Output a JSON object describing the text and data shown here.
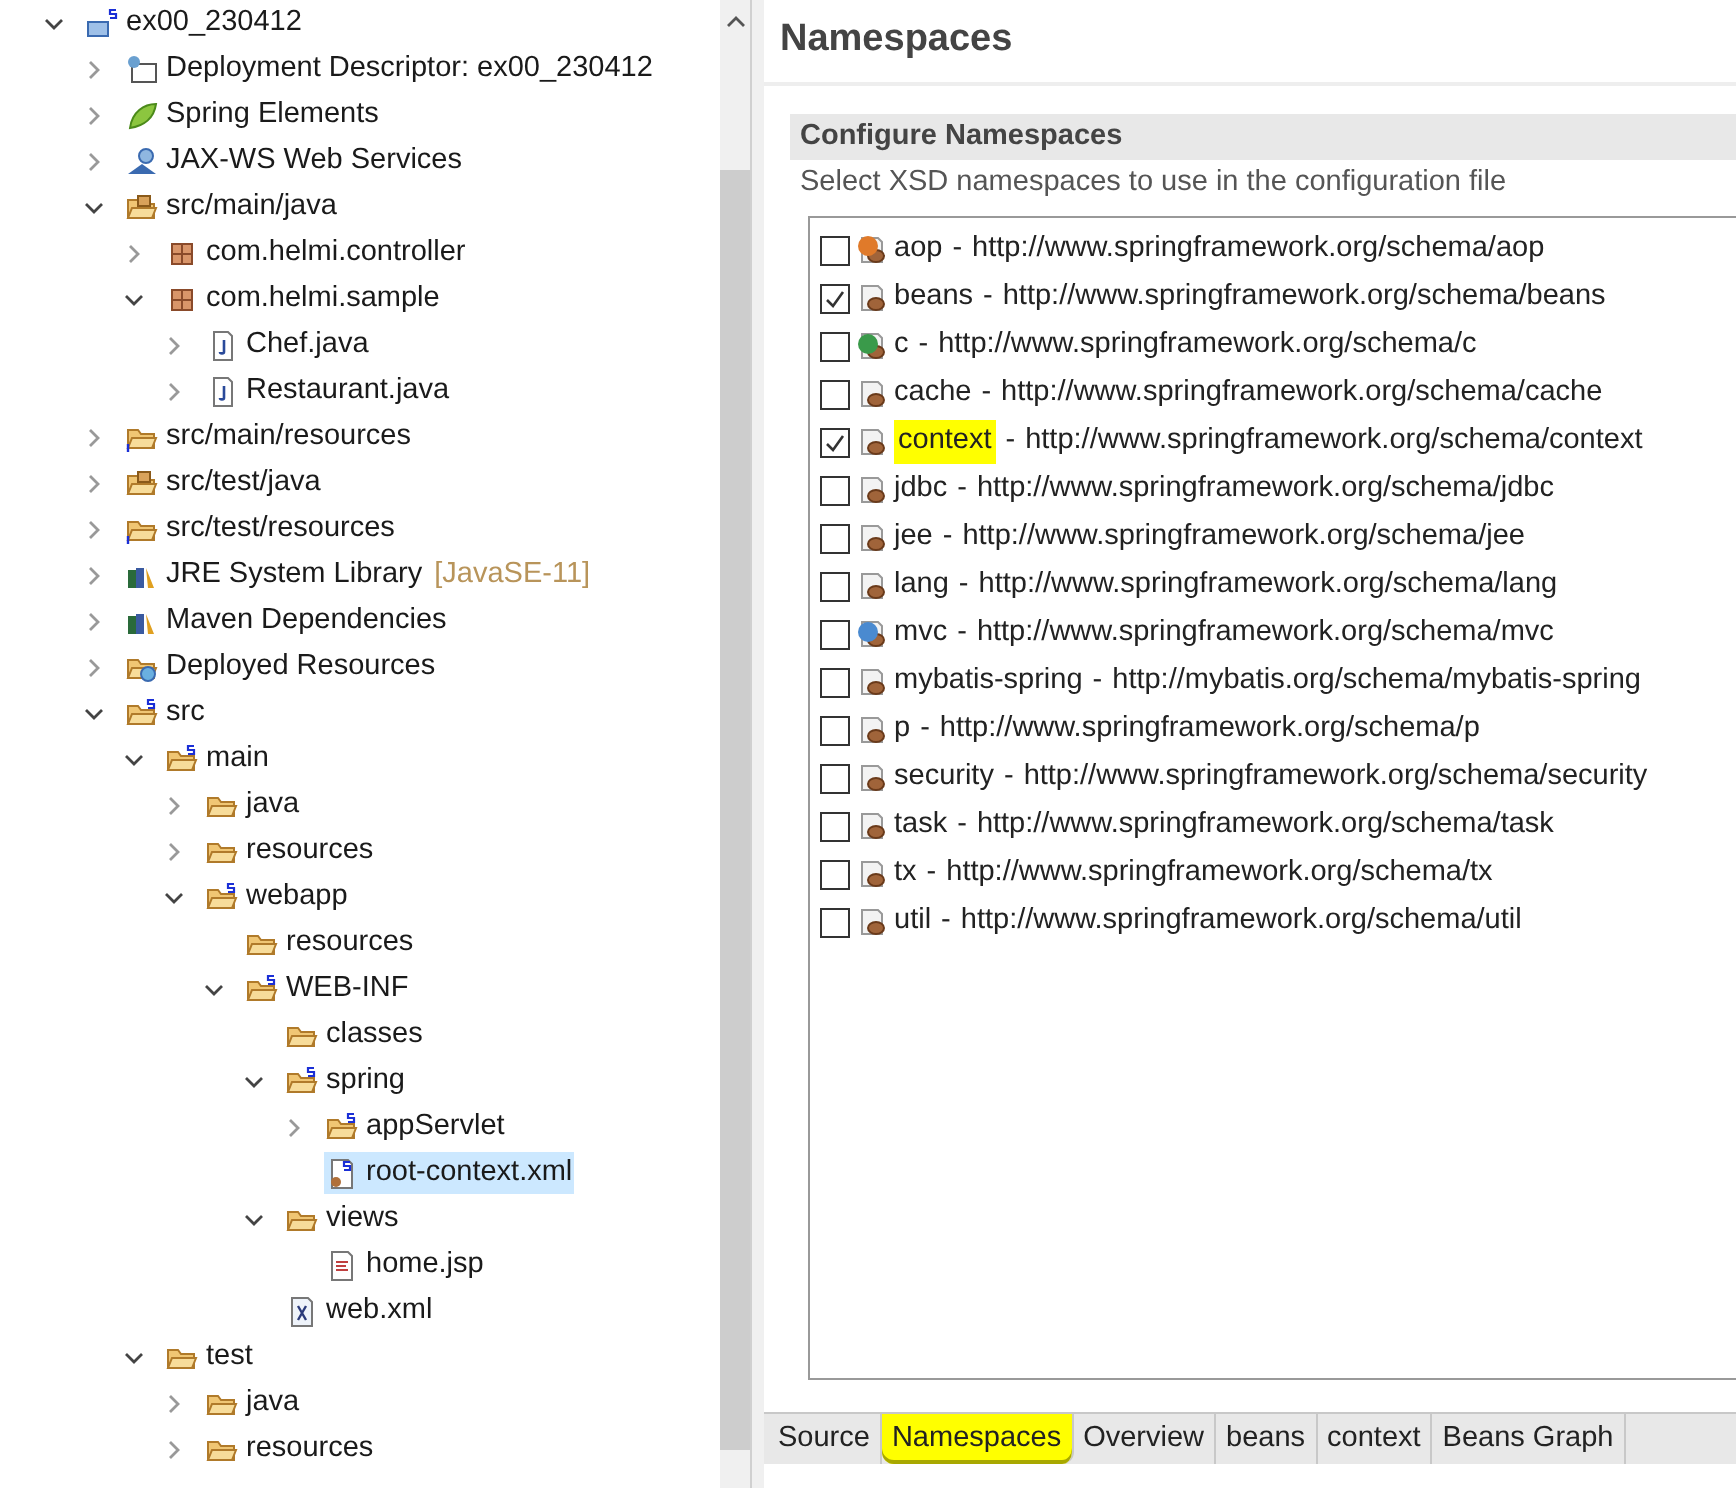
{
  "tree": [
    {
      "label": "ex00_230412",
      "kind": "project",
      "expanded": true,
      "children": [
        {
          "label": "Deployment Descriptor: ex00_230412",
          "kind": "descriptor",
          "expanded": false
        },
        {
          "label": "Spring Elements",
          "kind": "leaf",
          "expanded": false
        },
        {
          "label": "JAX-WS Web Services",
          "kind": "webservice",
          "expanded": false
        },
        {
          "label": "src/main/java",
          "kind": "source-folder",
          "expanded": true,
          "children": [
            {
              "label": "com.helmi.controller",
              "kind": "package",
              "expanded": false
            },
            {
              "label": "com.helmi.sample",
              "kind": "package",
              "expanded": true,
              "children": [
                {
                  "label": "Chef.java",
                  "kind": "java-file",
                  "expanded": false
                },
                {
                  "label": "Restaurant.java",
                  "kind": "java-file",
                  "expanded": false
                }
              ]
            }
          ]
        },
        {
          "label": "src/main/resources",
          "kind": "resource-folder",
          "expanded": false
        },
        {
          "label": "src/test/java",
          "kind": "source-folder",
          "expanded": false
        },
        {
          "label": "src/test/resources",
          "kind": "resource-folder",
          "expanded": false
        },
        {
          "label": "JRE System Library",
          "suffix": "[JavaSE-11]",
          "kind": "library",
          "expanded": false
        },
        {
          "label": "Maven Dependencies",
          "kind": "library",
          "expanded": false
        },
        {
          "label": "Deployed Resources",
          "kind": "deployed",
          "expanded": false
        },
        {
          "label": "src",
          "kind": "spring-folder",
          "expanded": true,
          "children": [
            {
              "label": "main",
              "kind": "spring-folder",
              "expanded": true,
              "children": [
                {
                  "label": "java",
                  "kind": "folder",
                  "expanded": false
                },
                {
                  "label": "resources",
                  "kind": "folder",
                  "expanded": false
                },
                {
                  "label": "webapp",
                  "kind": "spring-folder",
                  "expanded": true,
                  "children": [
                    {
                      "label": "resources",
                      "kind": "folder"
                    },
                    {
                      "label": "WEB-INF",
                      "kind": "spring-folder",
                      "expanded": true,
                      "children": [
                        {
                          "label": "classes",
                          "kind": "folder"
                        },
                        {
                          "label": "spring",
                          "kind": "spring-folder",
                          "expanded": true,
                          "children": [
                            {
                              "label": "appServlet",
                              "kind": "spring-folder",
                              "expanded": false
                            },
                            {
                              "label": "root-context.xml",
                              "kind": "spring-xml",
                              "selected": true
                            }
                          ]
                        },
                        {
                          "label": "views",
                          "kind": "folder",
                          "expanded": true,
                          "children": [
                            {
                              "label": "home.jsp",
                              "kind": "jsp-file"
                            }
                          ]
                        },
                        {
                          "label": "web.xml",
                          "kind": "xml-file"
                        }
                      ]
                    }
                  ]
                }
              ]
            },
            {
              "label": "test",
              "kind": "folder",
              "expanded": true,
              "children": [
                {
                  "label": "java",
                  "kind": "folder",
                  "expanded": false
                },
                {
                  "label": "resources",
                  "kind": "folder",
                  "expanded": false
                }
              ]
            }
          ]
        }
      ]
    }
  ],
  "editor": {
    "title": "Namespaces",
    "section": {
      "title": "Configure Namespaces",
      "description": "Select XSD namespaces to use in the configuration file"
    },
    "namespaces": [
      {
        "name": "aop",
        "separator": "-",
        "uri": "http://www.springframework.org/schema/aop",
        "checked": false,
        "highlighted": false
      },
      {
        "name": "beans",
        "separator": "-",
        "uri": "http://www.springframework.org/schema/beans",
        "checked": true,
        "highlighted": false
      },
      {
        "name": "c",
        "separator": "-",
        "uri": "http://www.springframework.org/schema/c",
        "checked": false,
        "highlighted": false
      },
      {
        "name": "cache",
        "separator": "-",
        "uri": "http://www.springframework.org/schema/cache",
        "checked": false,
        "highlighted": false
      },
      {
        "name": "context",
        "separator": "-",
        "uri": "http://www.springframework.org/schema/context",
        "checked": true,
        "highlighted": true
      },
      {
        "name": "jdbc",
        "separator": "-",
        "uri": "http://www.springframework.org/schema/jdbc",
        "checked": false,
        "highlighted": false
      },
      {
        "name": "jee",
        "separator": "-",
        "uri": "http://www.springframework.org/schema/jee",
        "checked": false,
        "highlighted": false
      },
      {
        "name": "lang",
        "separator": "-",
        "uri": "http://www.springframework.org/schema/lang",
        "checked": false,
        "highlighted": false
      },
      {
        "name": "mvc",
        "separator": "-",
        "uri": "http://www.springframework.org/schema/mvc",
        "checked": false,
        "highlighted": false
      },
      {
        "name": "mybatis-spring",
        "separator": "-",
        "uri": "http://mybatis.org/schema/mybatis-spring",
        "checked": false,
        "highlighted": false
      },
      {
        "name": "p",
        "separator": "-",
        "uri": "http://www.springframework.org/schema/p",
        "checked": false,
        "highlighted": false
      },
      {
        "name": "security",
        "separator": "-",
        "uri": "http://www.springframework.org/schema/security",
        "checked": false,
        "highlighted": false
      },
      {
        "name": "task",
        "separator": "-",
        "uri": "http://www.springframework.org/schema/task",
        "checked": false,
        "highlighted": false
      },
      {
        "name": "tx",
        "separator": "-",
        "uri": "http://www.springframework.org/schema/tx",
        "checked": false,
        "highlighted": false
      },
      {
        "name": "util",
        "separator": "-",
        "uri": "http://www.springframework.org/schema/util",
        "checked": false,
        "highlighted": false
      }
    ],
    "tabs": [
      {
        "label": "Source",
        "selected": false,
        "highlighted": false
      },
      {
        "label": "Namespaces",
        "selected": true,
        "highlighted": true
      },
      {
        "label": "Overview",
        "selected": false,
        "highlighted": false
      },
      {
        "label": "beans",
        "selected": false,
        "highlighted": false
      },
      {
        "label": "context",
        "selected": false,
        "highlighted": false
      },
      {
        "label": "Beans Graph",
        "selected": false,
        "highlighted": false
      }
    ]
  }
}
